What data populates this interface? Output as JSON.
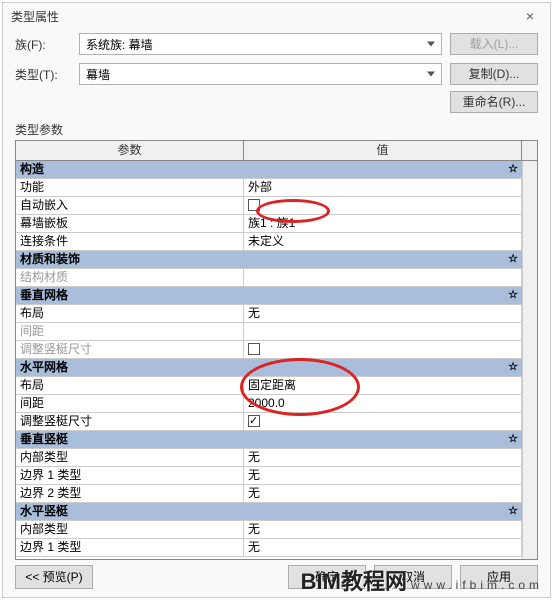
{
  "dialog": {
    "title": "类型属性",
    "close": "×"
  },
  "form": {
    "family_lbl": "族(F):",
    "family_val": "系统族: 幕墙",
    "type_lbl": "类型(T):",
    "type_val": "幕墙"
  },
  "buttons": {
    "load": "载入(L)...",
    "duplicate": "复制(D)...",
    "rename": "重命名(R)..."
  },
  "params_label": "类型参数",
  "headers": {
    "param": "参数",
    "value": "值"
  },
  "cat_construction": "构造",
  "r_function_p": "功能",
  "r_function_v": "外部",
  "r_autoembed_p": "自动嵌入",
  "r_wallpanel_p": "幕墙嵌板",
  "r_wallpanel_v": "族1 : 族1",
  "r_joincond_p": "连接条件",
  "r_joincond_v": "未定义",
  "cat_material": "材质和装饰",
  "r_strucmat_p": "结构材质",
  "cat_vgrid": "垂直网格",
  "r_vlayout_p": "布局",
  "r_vlayout_v": "无",
  "r_vspacing_p": "间距",
  "r_vadjust_p": "调整竖梃尺寸",
  "cat_hgrid": "水平网格",
  "r_hlayout_p": "布局",
  "r_hlayout_v": "固定距离",
  "r_hspacing_p": "间距",
  "r_hspacing_v": "2000.0",
  "r_hadjust_p": "调整竖梃尺寸",
  "cat_vmull": "垂直竖梃",
  "r_vinner_p": "内部类型",
  "r_vinner_v": "无",
  "r_vb1_p": "边界 1 类型",
  "r_vb1_v": "无",
  "r_vb2_p": "边界 2 类型",
  "r_vb2_v": "无",
  "cat_hmull": "水平竖梃",
  "r_hinner_p": "内部类型",
  "r_hinner_v": "无",
  "r_hb1_p": "边界 1 类型",
  "r_hb1_v": "无",
  "footer": {
    "preview": "<< 预览(P)",
    "ok": "确定",
    "cancel": "取消",
    "apply": "应用"
  },
  "watermark": {
    "big": "BIM教程网",
    "site": "www.ifbim.com"
  },
  "collapse": "☆"
}
